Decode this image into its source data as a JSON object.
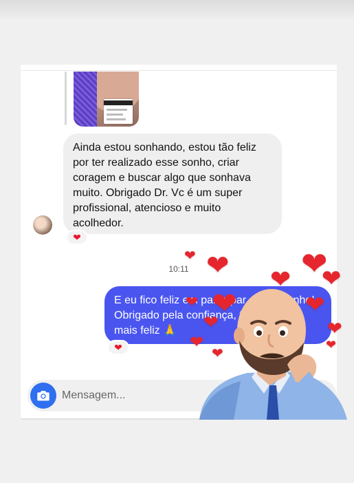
{
  "conversation": {
    "incoming_message": "Ainda estou sonhando, estou tão feliz por ter realizado esse sonho, criar coragem e buscar algo que sonhava muito. Obrigado Dr. Vc é um super profissional, atencioso e muito acolhedor.",
    "incoming_reaction": "❤️",
    "timestamp": "10:11",
    "outgoing_message": "E eu fico feliz em participar desse sonho! Obrigado pela confiança, fez meu dia mais feliz 🙏",
    "outgoing_reaction": "❤️"
  },
  "composer": {
    "placeholder": "Mensagem..."
  },
  "icons": {
    "camera": "camera-icon",
    "heart": "heart-icon"
  },
  "colors": {
    "outgoing_bubble": "#4a55f0",
    "camera_button": "#2f6ff0",
    "heart": "#e5262e"
  }
}
